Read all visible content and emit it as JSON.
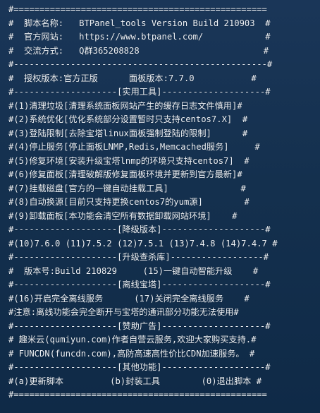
{
  "terminal": {
    "lines": [
      "#=================================================",
      "#  脚本名称:   BTPanel_tools Version Build 210903  #",
      "#  官方网站:   https://www.btpanel.com/            #",
      "#  交流方式:   Q群365208828                        #",
      "#-------------------------------------------------#",
      "#  授权版本:官方正版      面板版本:7.7.0           #",
      "#--------------------[实用工具]--------------------#",
      "#(1)清理垃圾[清理系统面板网站产生的缓存日志文件慎用]#",
      "#(2)系统优化[优化系统部分设置暂时只支持centos7.X]  #",
      "#(3)登陆限制[去除宝塔linux面板强制登陆的限制]      #",
      "#(4)停止服务[停止面板LNMP,Redis,Memcached服务]     #",
      "#(5)修复环境[安装升级宝塔lnmp的环境只支持centos7]  #",
      "#(6)修复面板[清理破解版修复面板环境并更新到官方最新]#",
      "#(7)挂载磁盘[官方的一键自动挂载工具]              #",
      "#(8)自动换源[目前只支持更换centos7的yum源]        #",
      "#(9)卸载面板[本功能会清空所有数据卸载网站环境]    #",
      "#--------------------[降级版本]--------------------#",
      "#(10)7.6.0 (11)7.5.2 (12)7.5.1 (13)7.4.8 (14)7.4.7 #",
      "#--------------------[升级查杀库]------------------#",
      "#  版本号:Build 210829     (15)一键自动智能升级    #",
      "#--------------------[离线宝塔]--------------------#",
      "#(16)开启完全离线服务      (17)关闭完全离线服务    #",
      "#注意:离线功能会完全断开与宝塔的通讯部分功能无法使用#",
      "#--------------------[赞助广告]--------------------#",
      "# 趣米云(qumiyun.com)作者自营云服务,欢迎大家购买支持.#",
      "# FUNCDN(funcdn.com),高防高速高性价比CDN加速服务。 #",
      "#--------------------[其他功能]--------------------#",
      "#(a)更新脚本         (b)封装工具        (0)退出脚本 #",
      "#================================================="
    ]
  }
}
